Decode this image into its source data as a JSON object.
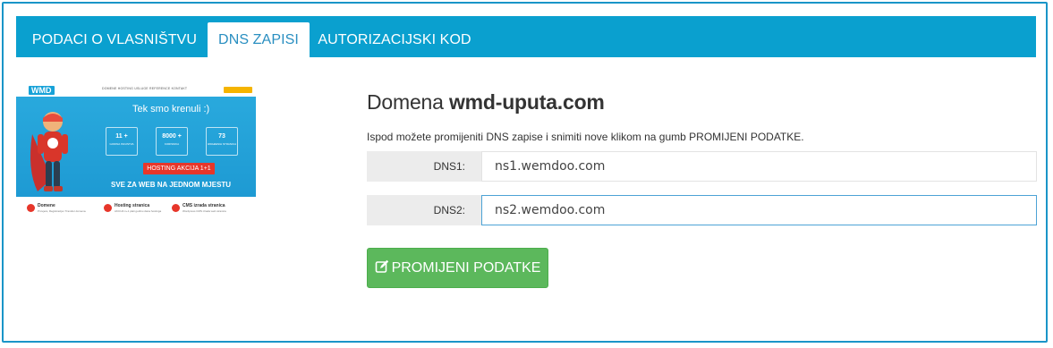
{
  "tabs": [
    {
      "label": "PODACI O VLASNIŠTVU",
      "active": false
    },
    {
      "label": "DNS ZAPISI",
      "active": true
    },
    {
      "label": "AUTORIZACIJSKI KOD",
      "active": false
    }
  ],
  "thumbnail": {
    "logo": "WMD",
    "menu": "DOMENE   HOSTING   USLUGE   REFERENCE   KONTAKT",
    "hero_title": "Tek smo krenuli :)",
    "stats": [
      {
        "value": "11 +",
        "label": "GODINA ISKUSTVA"
      },
      {
        "value": "8000 +",
        "label": "KORISNIKA"
      },
      {
        "value": "73",
        "label": "IZRAĐENIH STRANICA"
      }
    ],
    "hosting_button": "HOSTING AKCIJA 1+1",
    "tagline": "SVE ZA WEB NA JEDNOM MJESTU",
    "features": [
      {
        "title": "Domene",
        "desc": "Provjera, Registracija i Transfer domena."
      },
      {
        "title": "Hosting stranica",
        "desc": "AKCIJA 1+1 plati godinu dana hostinga"
      },
      {
        "title": "CMS izrada stranica",
        "desc": "Wordpress CMS izrada web stranica"
      }
    ]
  },
  "domain": {
    "prefix": "Domena",
    "name": "wmd-uputa.com"
  },
  "help_text": "Ispod možete promijeniti DNS zapise i snimiti nove klikom na gumb PROMIJENI PODATKE.",
  "dns": [
    {
      "label": "DNS1:",
      "value": "ns1.wemdoo.com"
    },
    {
      "label": "DNS2:",
      "value": "ns2.wemdoo.com"
    }
  ],
  "submit": {
    "label": "PROMIJENI PODATKE",
    "icon": "edit-icon",
    "color": "#5cb85c"
  },
  "colors": {
    "tab_bar": "#0aa0cf",
    "frame_border": "#1a95c8"
  }
}
